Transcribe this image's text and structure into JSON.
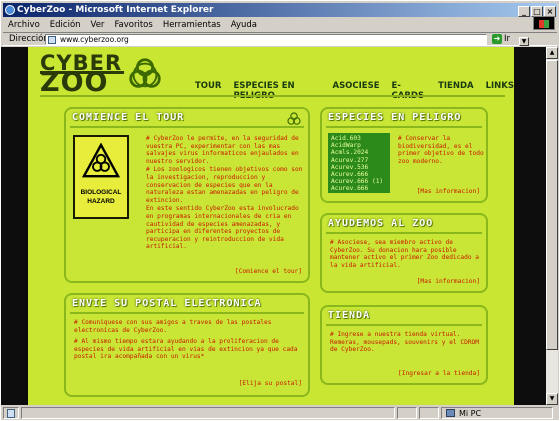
{
  "window": {
    "title": "CyberZoo - Microsoft Internet Explorer",
    "min_btn": "_",
    "max_btn": "□",
    "close_btn": "×"
  },
  "menu": [
    "Archivo",
    "Edición",
    "Ver",
    "Favoritos",
    "Herramientas",
    "Ayuda"
  ],
  "address": {
    "label": "Dirección",
    "url": "www.cyberzoo.org",
    "go_label": "Ir"
  },
  "status": {
    "zone": "Mi PC"
  },
  "site": {
    "logo_top": "CYBER",
    "logo_bottom": "ZOO",
    "nav": [
      "TOUR",
      "ESPECIES EN PELIGRO",
      "ASOCIESE",
      "E-CARDS",
      "TIENDA",
      "LINKS"
    ],
    "tour": {
      "heading": "COMIENCE EL TOUR",
      "badge_line1": "BIOLOGICAL",
      "badge_line2": "HAZARD",
      "p1": "# CyberZoo le permite, en la seguridad de vuestra PC, experimentar con las mas salvajes virus informaticos enjaulados en nuestro servidor.",
      "p2": "# Los zoologicos tienen objetivos como son la investigacion, reproduccion y conservacion de especies que en la naturaleza estan amenazadas en peligro de extincion.",
      "p3": "En este sentido CyberZoo esta involucrado en programas internacionales de cria en cautividad de especies amenazadas, y participa en diferentes proyectos de recuperacion y reintroduccion de vida artificial.",
      "link": "[Comience el tour]"
    },
    "postal": {
      "heading": "ENVIE SU POSTAL ELECTRONICA",
      "p1": "# Comuniquese con sus amigos a traves de las postales electronicas de CyberZoo.",
      "p2": "# Al mismo tiempo estara ayudando a la proliferacion de especies de vida artificial en vias de extincion ya que cada postal ira acompañada con un virus*",
      "link": "[Elija su postal]"
    },
    "species": {
      "heading": "ESPECIES EN PELIGRO",
      "list": [
        "Acid.603",
        "AcidWarp",
        "Acmls.2024",
        "Acurev.277",
        "Acurev.536",
        "Acurev.666",
        "Acurev.666 (1)",
        "Acurev.666"
      ],
      "text": "# Conservar la biodiversidad, es el primer objetivo de todo zoo moderno.",
      "link": "[Mas informacion]"
    },
    "help": {
      "heading": "AYUDEMOS AL ZOO",
      "text": "# Asociese, sea miembro activo de CyberZoo. Su donacion hara posible mantener activo el primer Zoo dedicado a la vida artificial.",
      "link": "[Mas informacion]"
    },
    "shop": {
      "heading": "TIENDA",
      "text": "# Ingrese a nuestra tienda virtual. Remeras, mousepads, souvenirs y el CDROM de CyberZoo.",
      "link": "[Ingresar a la tienda]"
    }
  },
  "colors": {
    "page_bg": "#c8e632",
    "text_red": "#c81800",
    "panel_border": "#8ab81c",
    "species_box": "#2c8a1a"
  }
}
